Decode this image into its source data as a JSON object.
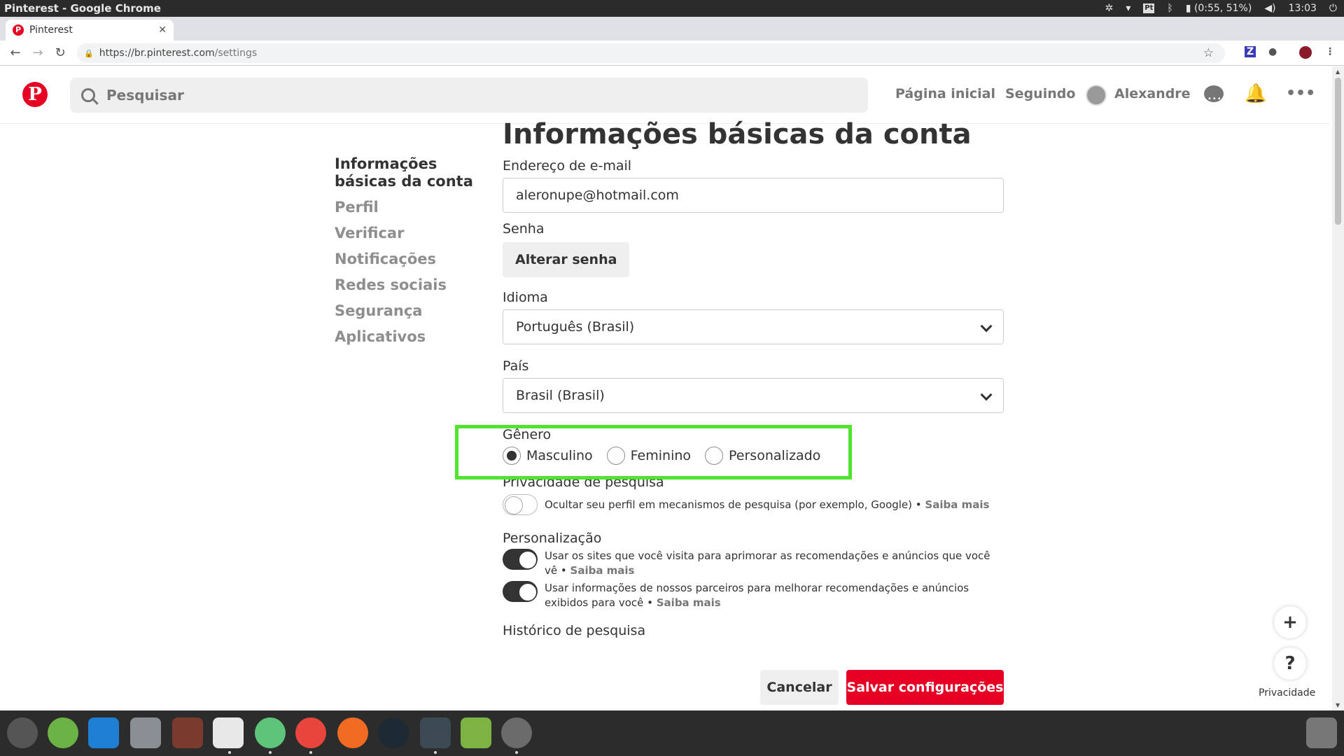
{
  "os": {
    "window_title": "Pinterest - Google Chrome",
    "pt_indicator": "Pt",
    "battery": "(0:55, 51%)",
    "clock": "13:03"
  },
  "browser": {
    "tab_title": "Pinterest",
    "tab_favicon": "P",
    "url_host": "https://br.pinterest.com",
    "url_path": "/settings",
    "ext_z": "Z"
  },
  "header": {
    "logo_letter": "P",
    "search_placeholder": "Pesquisar",
    "nav_home": "Página inicial",
    "nav_following": "Seguindo",
    "user_name": "Alexandre",
    "more": "•••"
  },
  "sidebar": {
    "items": [
      {
        "label": "Informações básicas da conta",
        "active": true
      },
      {
        "label": "Perfil"
      },
      {
        "label": "Verificar"
      },
      {
        "label": "Notificações"
      },
      {
        "label": "Redes sociais"
      },
      {
        "label": "Segurança"
      },
      {
        "label": "Aplicativos"
      }
    ]
  },
  "settings": {
    "title": "Informações básicas da conta",
    "email_label": "Endereço de e-mail",
    "email_value": "aleronupe@hotmail.com",
    "password_label": "Senha",
    "password_button": "Alterar senha",
    "language_label": "Idioma",
    "language_value": "Português (Brasil)",
    "country_label": "País",
    "country_value": "Brasil (Brasil)",
    "gender_label": "Gênero",
    "gender_options": [
      "Masculino",
      "Feminino",
      "Personalizado"
    ],
    "gender_selected": "Masculino",
    "search_privacy_label": "Privacidade de pesquisa",
    "search_privacy_text": "Ocultar seu perfil em mecanismos de pesquisa (por exemplo, Google) •",
    "learn_more": "Saiba mais",
    "personalization_label": "Personalização",
    "personalization_1": "Usar os sites que você visita para aprimorar as recomendações e anúncios que você vê •",
    "personalization_2": "Usar informações de nossos parceiros para melhorar recomendações e anúncios exibidos para você •",
    "search_history_label": "Histórico de pesquisa",
    "cancel_button": "Cancelar",
    "save_button": "Salvar configurações"
  },
  "floating": {
    "plus": "+",
    "help": "?",
    "privacy": "Privacidade"
  },
  "colors": {
    "brand_red": "#e60023",
    "highlight_green": "#50e42f"
  }
}
